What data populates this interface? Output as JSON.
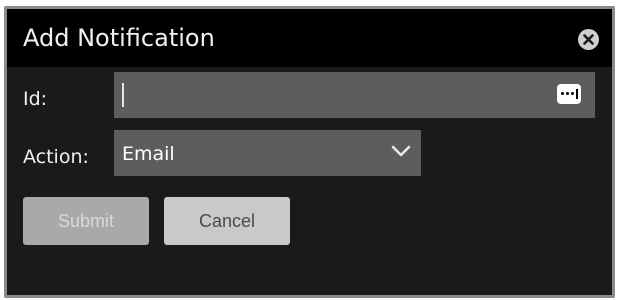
{
  "dialog": {
    "title": "Add Notification",
    "close_icon": "close-circle-icon"
  },
  "form": {
    "id_label": "Id:",
    "id_value": "",
    "id_field_icon": "password-dots-icon",
    "action_label": "Action:",
    "action_selected": "Email",
    "action_dropdown_icon": "chevron-down-icon"
  },
  "buttons": {
    "submit_label": "Submit",
    "submit_enabled": false,
    "cancel_label": "Cancel"
  },
  "colors": {
    "titlebar": "#000000",
    "body": "#1a1a1a",
    "field": "#5d5d5d",
    "submit_disabled": "#a9a9a9",
    "cancel": "#c9c9c9"
  }
}
